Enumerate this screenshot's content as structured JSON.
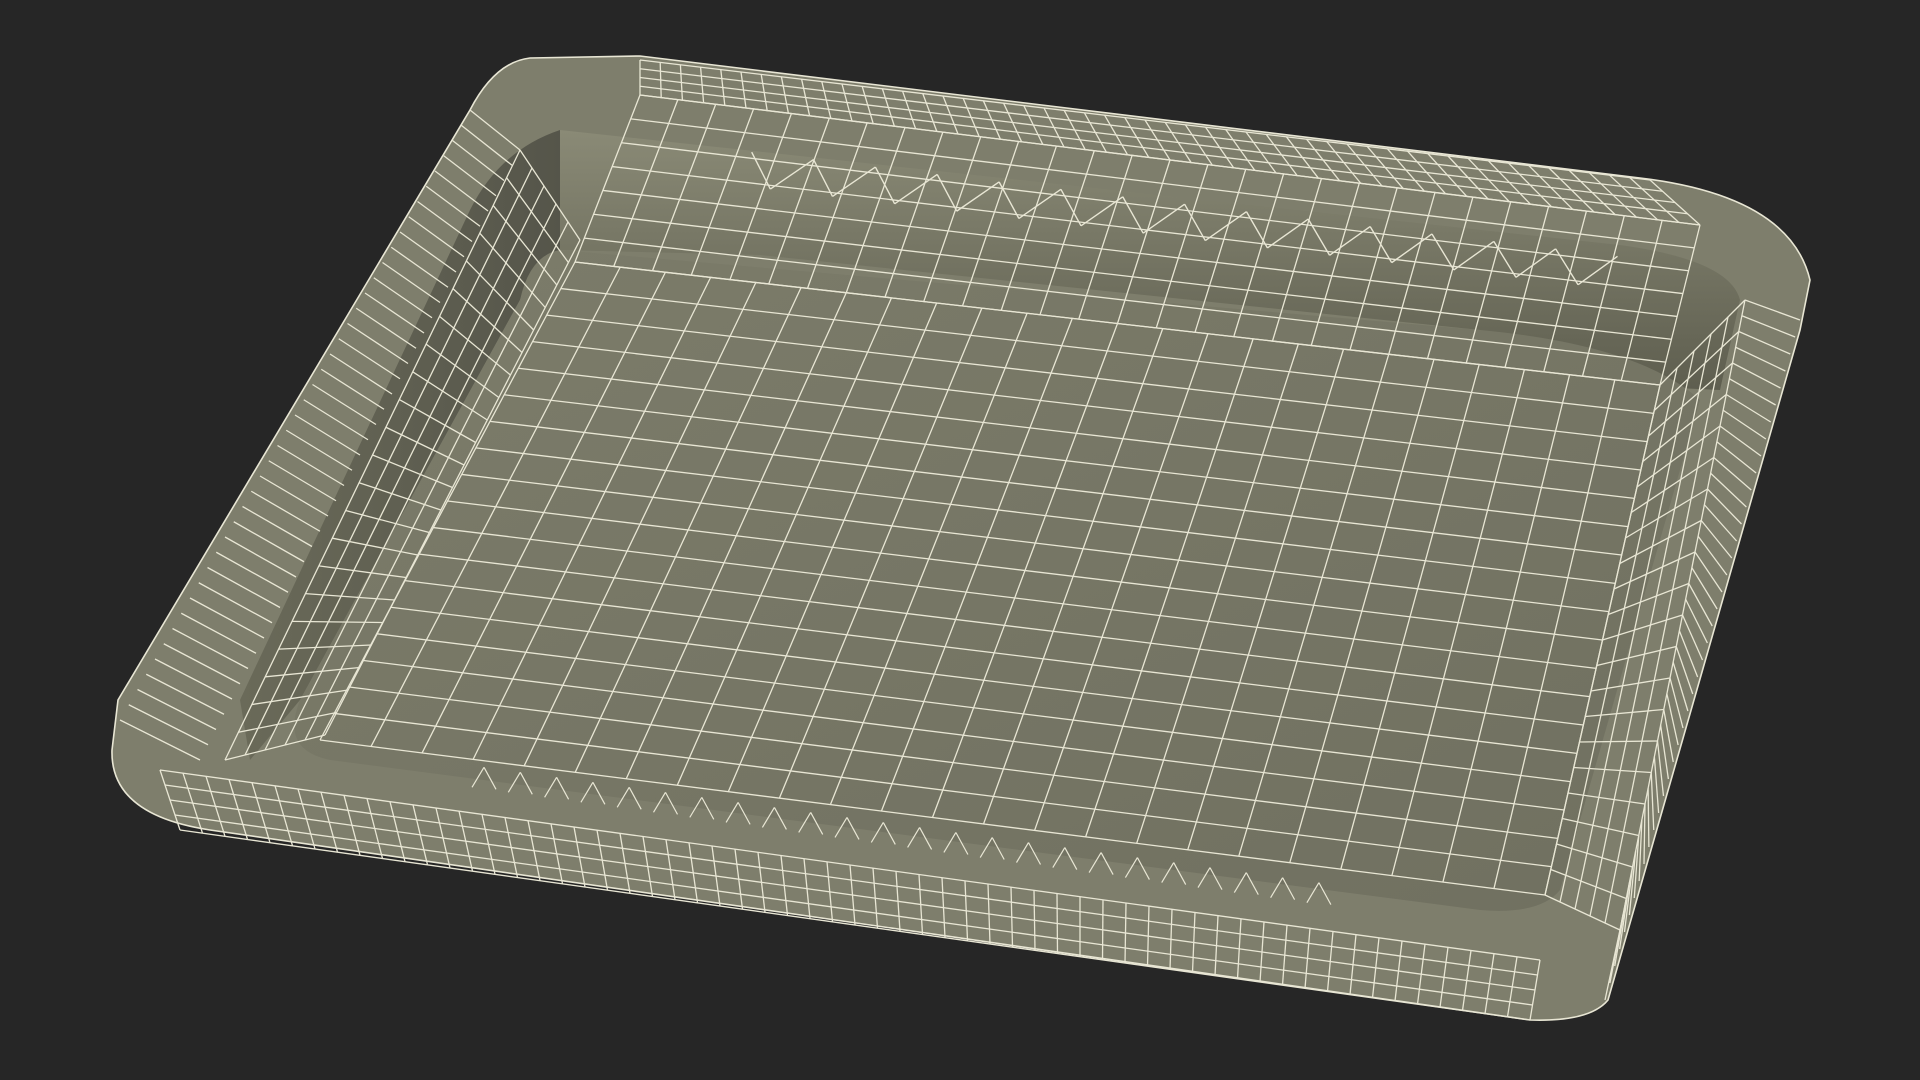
{
  "scene": {
    "subject": "foam-tray-wireframe",
    "background_color": "#262626",
    "surface_color": "#787866",
    "surface_shade_color": "#5f5f50",
    "rim_color": "#828270",
    "wire_color": "#e8e6d4"
  }
}
